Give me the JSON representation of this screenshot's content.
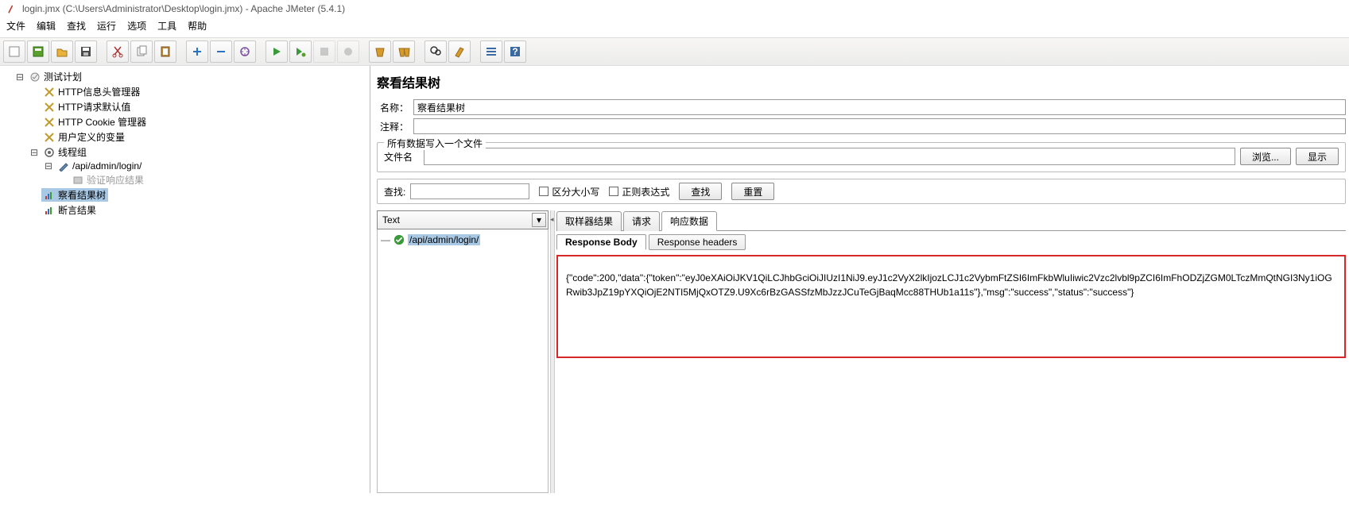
{
  "titlebar": {
    "text": "login.jmx (C:\\Users\\Administrator\\Desktop\\login.jmx) - Apache JMeter (5.4.1)"
  },
  "menu": {
    "file": "文件",
    "edit": "编辑",
    "search": "查找",
    "run": "运行",
    "options": "选项",
    "tools": "工具",
    "help": "帮助"
  },
  "tree": {
    "plan": "测试计划",
    "header_mgr": "HTTP信息头管理器",
    "req_defaults": "HTTP请求默认值",
    "cookie_mgr": "HTTP Cookie 管理器",
    "user_vars": "用户定义的变量",
    "thread_group": "线程组",
    "sampler": "/api/admin/login/",
    "assert": "验证响应结果",
    "view_tree": "察看结果树",
    "assert_res": "断言结果"
  },
  "panel": {
    "heading": "察看结果树",
    "name_label": "名称：",
    "name_value": "察看结果树",
    "comment_label": "注释：",
    "groupbox_legend": "所有数据写入一个文件",
    "filename_label": "文件名",
    "browse": "浏览...",
    "show_log": "显示"
  },
  "searchbar": {
    "label": "查找:",
    "case": "区分大小写",
    "regex": "正则表达式",
    "search_btn": "查找",
    "reset_btn": "重置"
  },
  "results": {
    "dropdown": "Text",
    "sample": "/api/admin/login/",
    "tabs": {
      "sampler": "取样器结果",
      "request": "请求",
      "response": "响应数据"
    },
    "subtabs": {
      "body": "Response Body",
      "headers": "Response headers"
    },
    "body": "{\"code\":200,\"data\":{\"token\":\"eyJ0eXAiOiJKV1QiLCJhbGciOiJIUzI1NiJ9.eyJ1c2VyX2lkIjozLCJ1c2VybmFtZSI6ImFkbWluIiwic2Vzc2lvbl9pZCI6ImFhODZjZGM0LTczMmQtNGI3Ny1iOGRwib3JpZ19pYXQiOjE2NTI5MjQxOTZ9.U9Xc6rBzGASSfzMbJzzJCuTeGjBaqMcc88THUb1a11s\"},\"msg\":\"success\",\"status\":\"success\"}"
  }
}
